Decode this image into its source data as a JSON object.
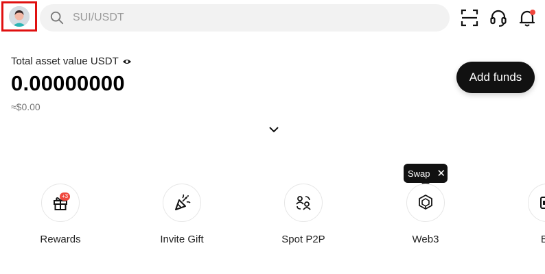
{
  "header": {
    "search_placeholder": "SUI/USDT"
  },
  "asset": {
    "label": "Total asset value USDT",
    "value": "0.00000000",
    "fiat": "≈$0.00",
    "add_funds": "Add funds"
  },
  "tooltip": {
    "text": "Swap",
    "close": "✕"
  },
  "shortcuts": [
    {
      "label": "Rewards",
      "badge": "+3",
      "icon": "gift-icon"
    },
    {
      "label": "Invite Gift",
      "icon": "party-popper-icon"
    },
    {
      "label": "Spot P2P",
      "icon": "p2p-icon"
    },
    {
      "label": "Web3",
      "icon": "web3-cube-icon"
    },
    {
      "label": "Bo",
      "icon": "partial-icon"
    }
  ],
  "colors": {
    "highlight_border": "#e01010",
    "button_bg": "#111111",
    "badge_red": "#ef4a3e"
  }
}
